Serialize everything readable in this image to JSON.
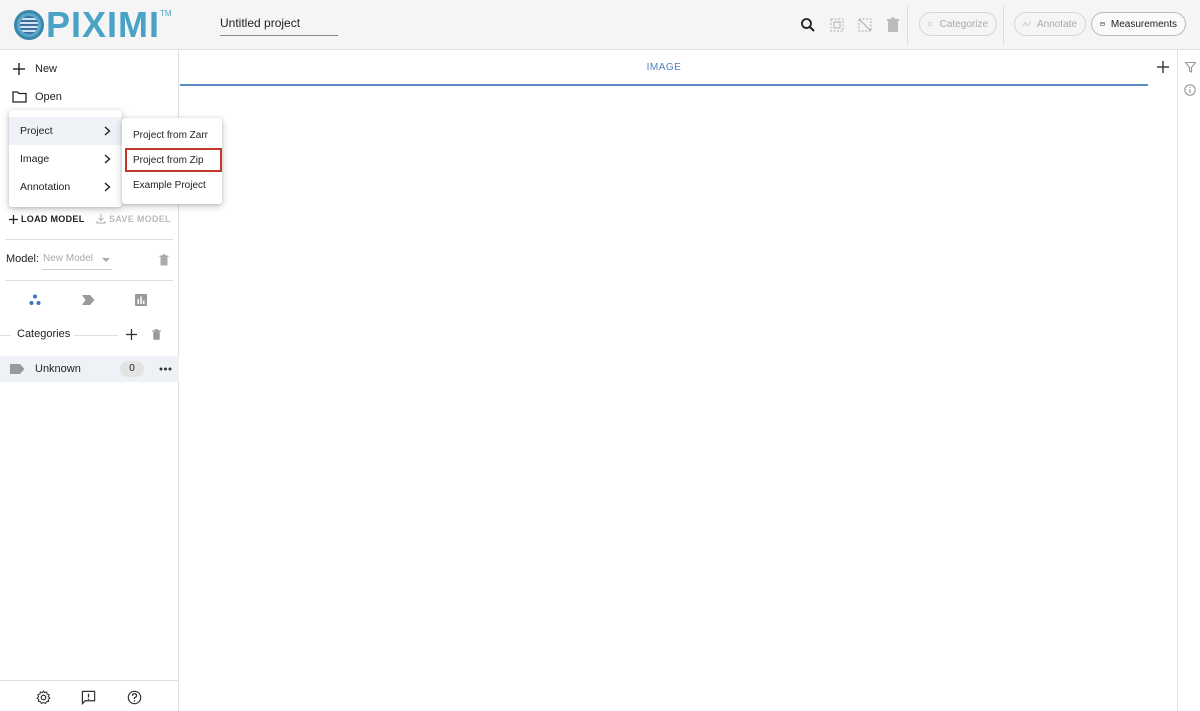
{
  "app": {
    "logo_text": "PIXIMI",
    "logo_tm": "TM",
    "project_title": "Untitled project"
  },
  "toolbar": {
    "categorize_label": "Categorize",
    "annotate_label": "Annotate",
    "measurements_label": "Measurements"
  },
  "sidebar": {
    "new_label": "New",
    "open_label": "Open",
    "load_model_label": "LOAD MODEL",
    "save_model_label": "SAVE MODEL",
    "model_label": "Model:",
    "model_value": "New Model",
    "categories_label": "Categories",
    "categories": [
      {
        "name": "Unknown",
        "count": "0"
      }
    ]
  },
  "main": {
    "tab_label": "IMAGE"
  },
  "open_menu": {
    "items": [
      {
        "label": "Project"
      },
      {
        "label": "Image"
      },
      {
        "label": "Annotation"
      }
    ]
  },
  "project_submenu": {
    "items": [
      {
        "label": "Project from Zarr"
      },
      {
        "label": "Project from Zip"
      },
      {
        "label": "Example Project"
      }
    ]
  },
  "colors": {
    "accent": "#4f7fbf",
    "logo": "#4aa3c7",
    "highlight_border": "#c0392b"
  }
}
